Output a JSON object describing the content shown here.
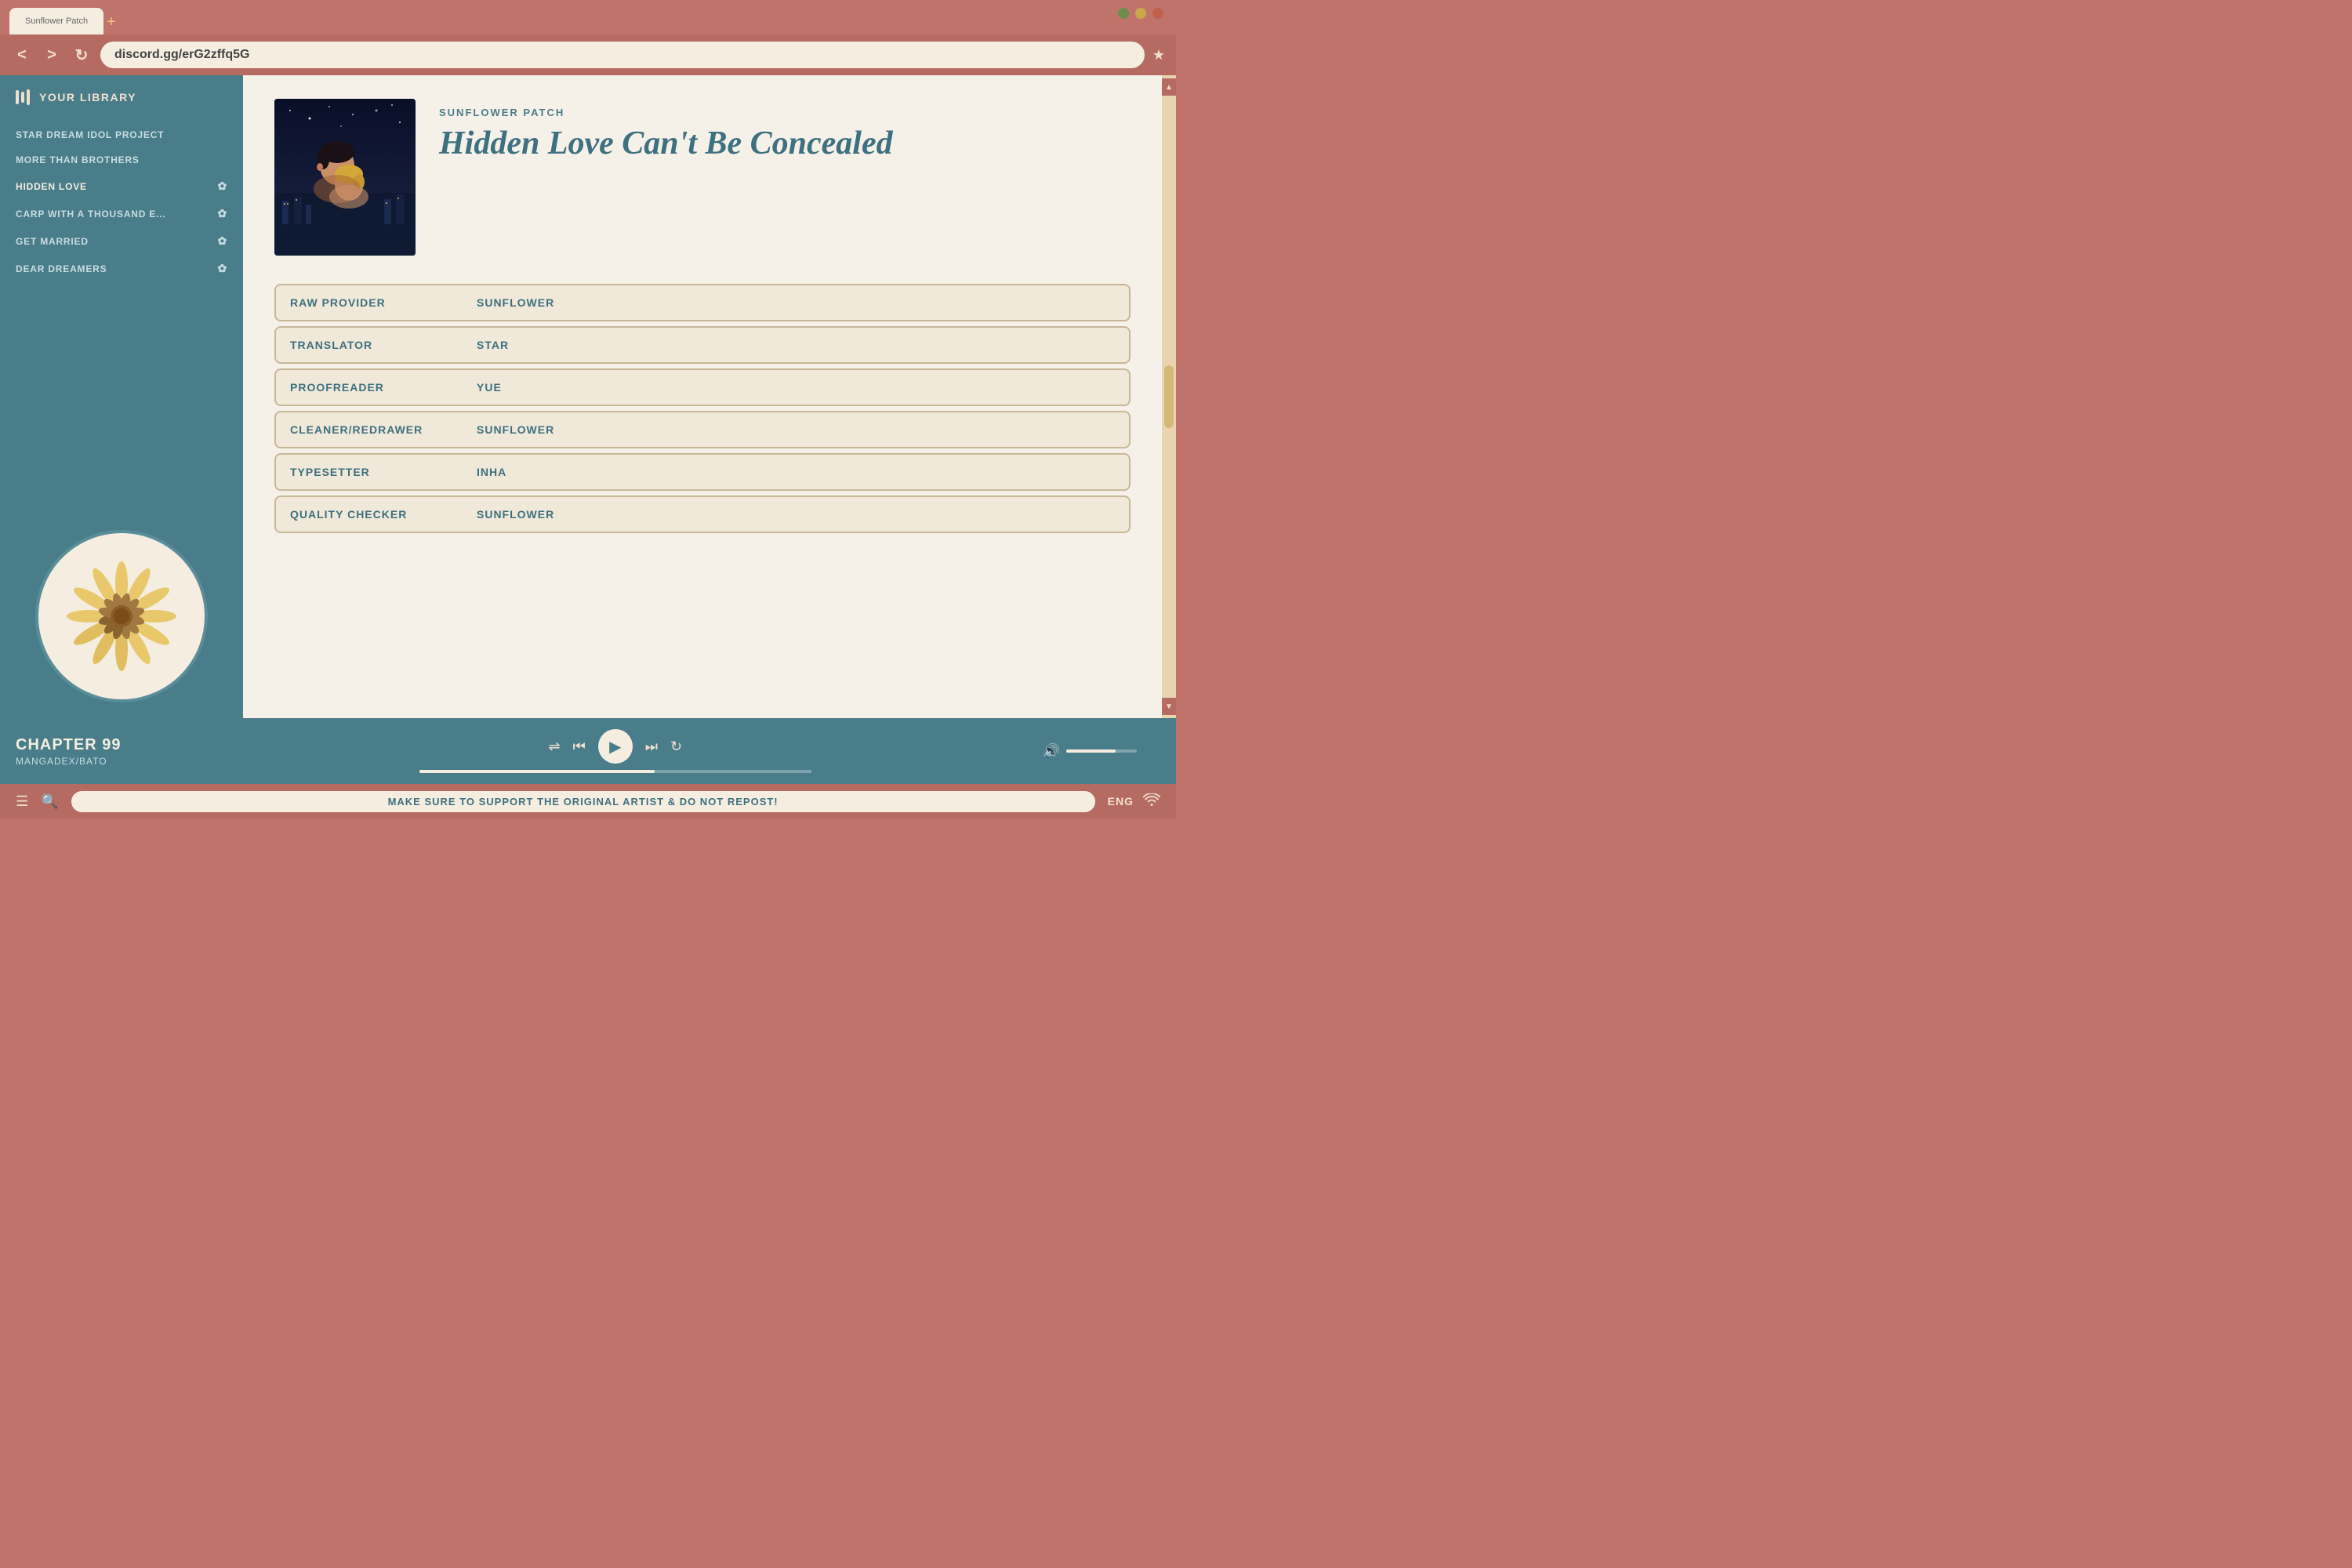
{
  "browser": {
    "tab_label": "Sunflower Patch",
    "tab_add_icon": "+",
    "url": "discord.gg/erG2zffq5G",
    "bookmark_icon": "★",
    "nav_back": "<",
    "nav_forward": ">",
    "nav_refresh": "↻",
    "window_controls": [
      "green",
      "yellow",
      "red"
    ]
  },
  "sidebar": {
    "header_title": "YOUR LIBRARY",
    "items": [
      {
        "label": "STAR DREAM IDOL PROJECT",
        "has_icon": false
      },
      {
        "label": "MORE THAN BROTHERS",
        "has_icon": false
      },
      {
        "label": "HIDDEN LOVE",
        "has_icon": true
      },
      {
        "label": "CARP WITH A THOUSAND E...",
        "has_icon": true
      },
      {
        "label": "GET MARRIED",
        "has_icon": true
      },
      {
        "label": "DEAR DREAMERS",
        "has_icon": true
      }
    ]
  },
  "book": {
    "publisher": "SUNFLOWER PATCH",
    "title": "Hidden Love Can't Be Concealed",
    "credits": [
      {
        "role": "RAW PROVIDER",
        "value": "SUNFLOWER"
      },
      {
        "role": "TRANSLATOR",
        "value": "STAR"
      },
      {
        "role": "PROOFREADER",
        "value": "YUE"
      },
      {
        "role": "CLEANER/REDRAWER",
        "value": "SUNFLOWER"
      },
      {
        "role": "TYPESETTER",
        "value": "INHA"
      },
      {
        "role": "QUALITY CHECKER",
        "value": "SUNFLOWER"
      }
    ]
  },
  "player": {
    "chapter": "CHAPTER 99",
    "source": "MANGADEX/BATO",
    "shuffle_icon": "⇌",
    "prev_icon": "⏮",
    "play_icon": "▶",
    "next_icon": "⏭",
    "repeat_icon": "↻",
    "volume_icon": "🔊",
    "progress": 60,
    "volume": 70
  },
  "status_bar": {
    "menu_icon": "☰",
    "search_icon": "🔍",
    "message": "MAKE SURE TO SUPPORT THE ORIGINAL ARTIST & DO NOT REPOST!",
    "language": "ENG",
    "wifi_icon": "WiFi"
  }
}
